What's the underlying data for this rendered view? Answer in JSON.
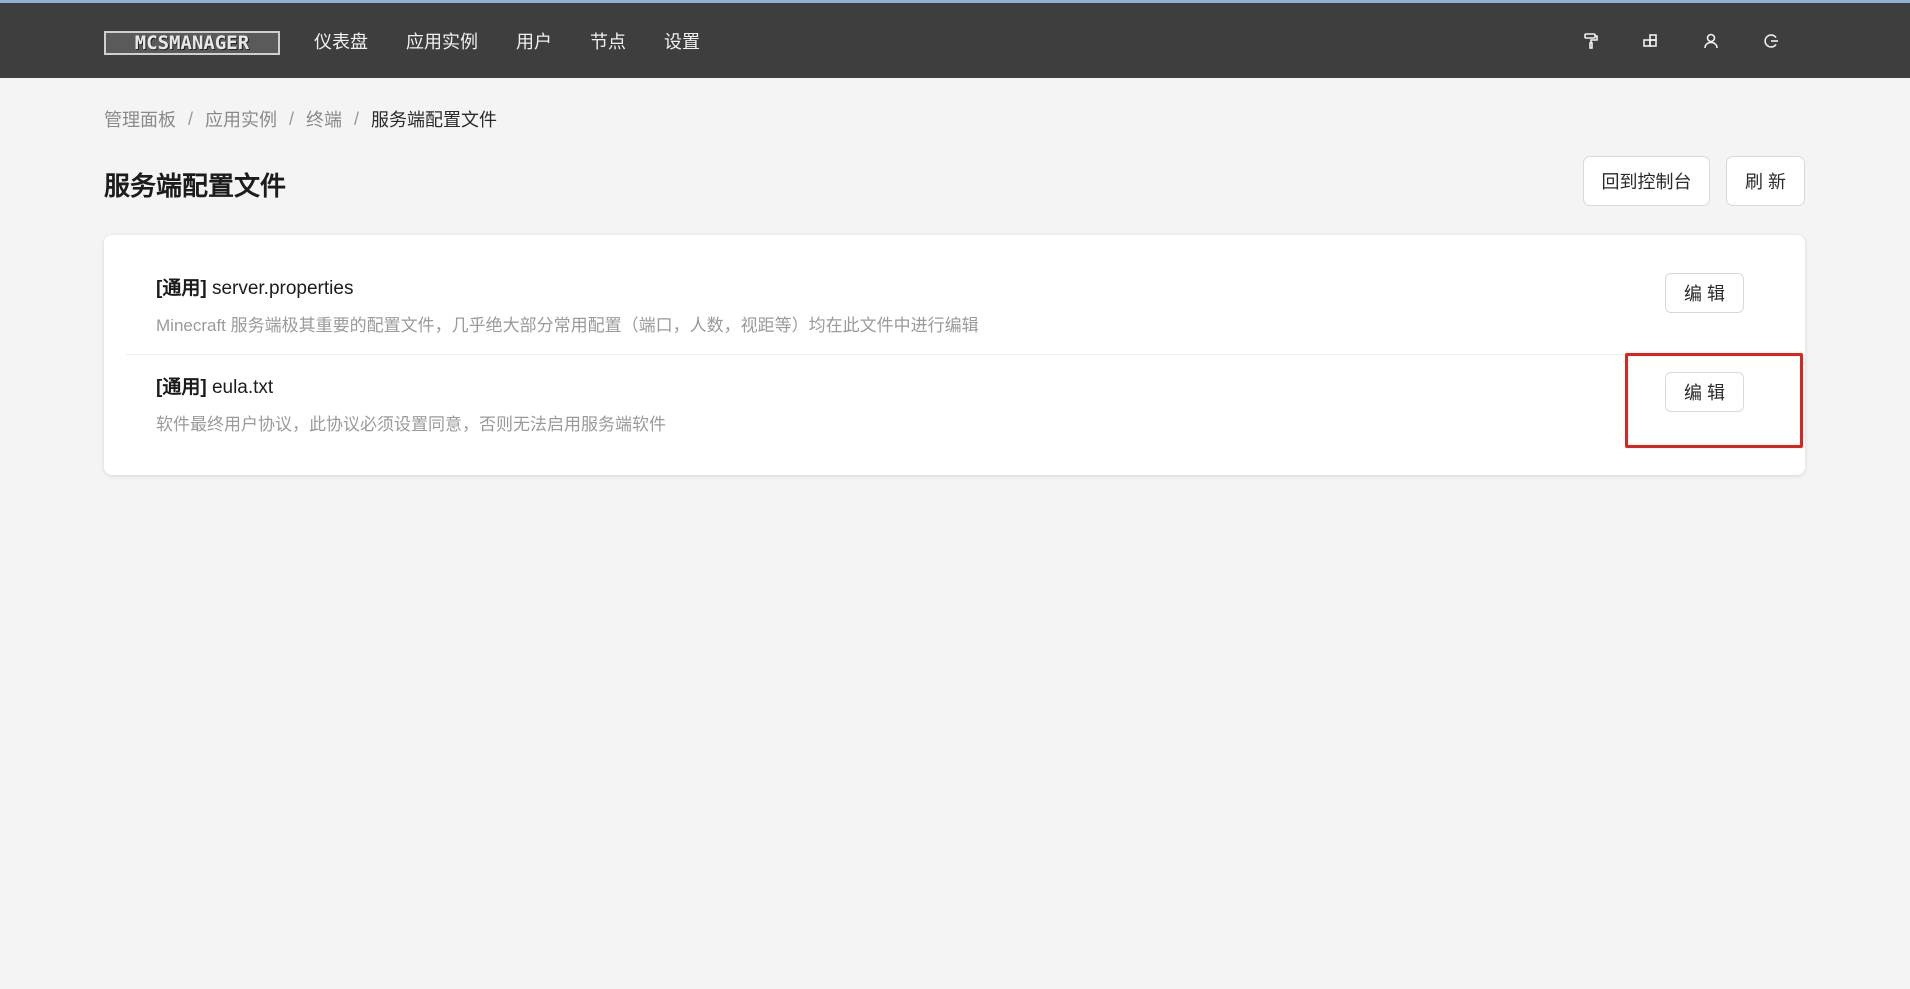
{
  "app": {
    "logo_text": "MCSMANAGER"
  },
  "nav": {
    "items": [
      {
        "label": "仪表盘"
      },
      {
        "label": "应用实例"
      },
      {
        "label": "用户"
      },
      {
        "label": "节点"
      },
      {
        "label": "设置"
      }
    ]
  },
  "top_icons": [
    "paint-roller-icon",
    "layout-icon",
    "user-icon",
    "logout-icon"
  ],
  "breadcrumb": {
    "items": [
      "管理面板",
      "应用实例",
      "终端"
    ],
    "current": "服务端配置文件",
    "separator": "/"
  },
  "page": {
    "title": "服务端配置文件",
    "back_button": "回到控制台",
    "refresh_button": "刷 新"
  },
  "files": [
    {
      "tag": "[通用]",
      "name": "server.properties",
      "description": "Minecraft 服务端极其重要的配置文件，几乎绝大部分常用配置（端口，人数，视距等）均在此文件中进行编辑",
      "edit_label": "编 辑"
    },
    {
      "tag": "[通用]",
      "name": "eula.txt",
      "description": "软件最终用户协议，此协议必须设置同意，否则无法启用服务端软件",
      "edit_label": "编 辑"
    }
  ],
  "colors": {
    "topbar": "#3e3e3e",
    "background": "#f4f4f4",
    "highlight": "#e0241c"
  }
}
